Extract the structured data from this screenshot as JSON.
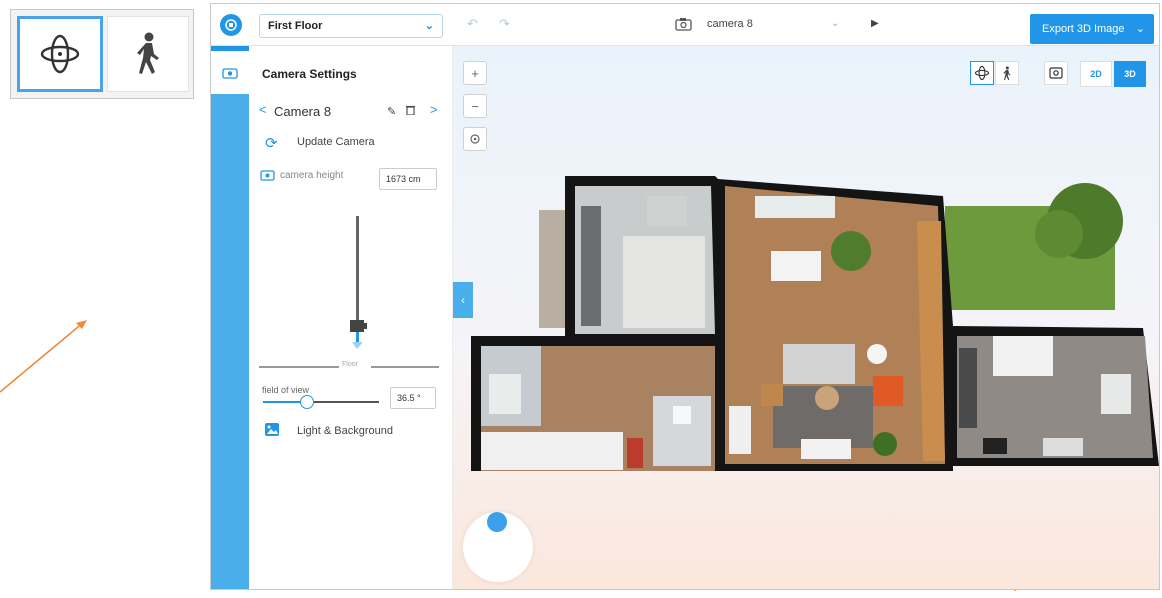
{
  "colors": {
    "accent": "#2196e8",
    "rail": "#4aaeea",
    "arrow": "#f0883e"
  },
  "callout": {
    "orbit_icon": "orbit-icon",
    "walk_icon": "walk-person-icon"
  },
  "toolbar": {
    "floor_select": "First Floor",
    "camera_select": "camera 8",
    "export_label": "Export 3D Image"
  },
  "panel": {
    "title": "Camera Settings",
    "camera_name": "Camera 8",
    "update_label": "Update Camera",
    "camera_height_label": "camera height",
    "camera_height_value": "1673 cm",
    "floor_label": "Floor",
    "fov_label": "field of view",
    "fov_value": "36.5 °",
    "fov_level": 0.38,
    "light_label": "Light & Background"
  },
  "view": {
    "btn_2d": "2D",
    "btn_3d": "3D",
    "active_mode": "3D"
  }
}
